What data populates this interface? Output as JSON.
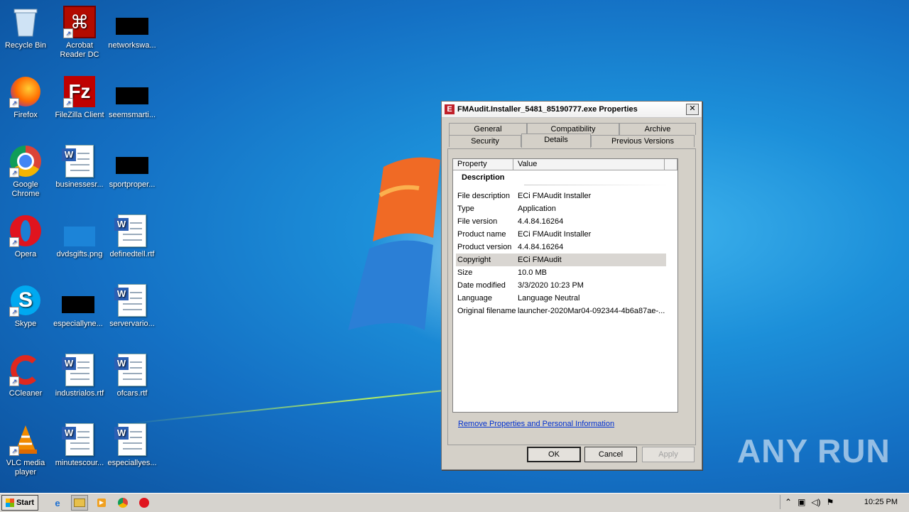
{
  "desktop": {
    "icons": [
      {
        "label": "Recycle Bin"
      },
      {
        "label": "Acrobat Reader DC"
      },
      {
        "label": "networkswa..."
      },
      {
        "label": "Firefox"
      },
      {
        "label": "FileZilla Client"
      },
      {
        "label": "seemsmarti..."
      },
      {
        "label": "Google Chrome"
      },
      {
        "label": "businessesr..."
      },
      {
        "label": "sportproper..."
      },
      {
        "label": "Opera"
      },
      {
        "label": "dvdsgifts.png"
      },
      {
        "label": "definedtell.rtf"
      },
      {
        "label": "Skype"
      },
      {
        "label": "especiallyne..."
      },
      {
        "label": "servervario..."
      },
      {
        "label": "CCleaner"
      },
      {
        "label": "industrialos.rtf"
      },
      {
        "label": "ofcars.rtf"
      },
      {
        "label": "VLC media player"
      },
      {
        "label": "minutescour..."
      },
      {
        "label": "especiallyes..."
      }
    ]
  },
  "watermark": "ANY RUN",
  "dialog": {
    "title": "FMAudit.Installer_5481_85190777.exe Properties",
    "close_symbol": "✕",
    "tabs_row1": [
      "General",
      "Compatibility",
      "Archive"
    ],
    "tabs_row2": [
      "Security",
      "Details",
      "Previous Versions"
    ],
    "active_tab": "Details",
    "columns": {
      "property": "Property",
      "value": "Value"
    },
    "section": "Description",
    "rows": [
      {
        "property": "File description",
        "value": "ECi FMAudit Installer"
      },
      {
        "property": "Type",
        "value": "Application"
      },
      {
        "property": "File version",
        "value": "4.4.84.16264"
      },
      {
        "property": "Product name",
        "value": "ECi FMAudit Installer"
      },
      {
        "property": "Product version",
        "value": "4.4.84.16264"
      },
      {
        "property": "Copyright",
        "value": "ECi FMAudit"
      },
      {
        "property": "Size",
        "value": "10.0 MB"
      },
      {
        "property": "Date modified",
        "value": "3/3/2020 10:23 PM"
      },
      {
        "property": "Language",
        "value": "Language Neutral"
      },
      {
        "property": "Original filename",
        "value": "launcher-2020Mar04-092344-4b6a87ae-..."
      }
    ],
    "selected_row": "Copyright",
    "link": "Remove Properties and Personal Information",
    "buttons": {
      "ok": "OK",
      "cancel": "Cancel",
      "apply": "Apply"
    }
  },
  "taskbar": {
    "start_label": "Start",
    "clock": "10:25 PM"
  }
}
